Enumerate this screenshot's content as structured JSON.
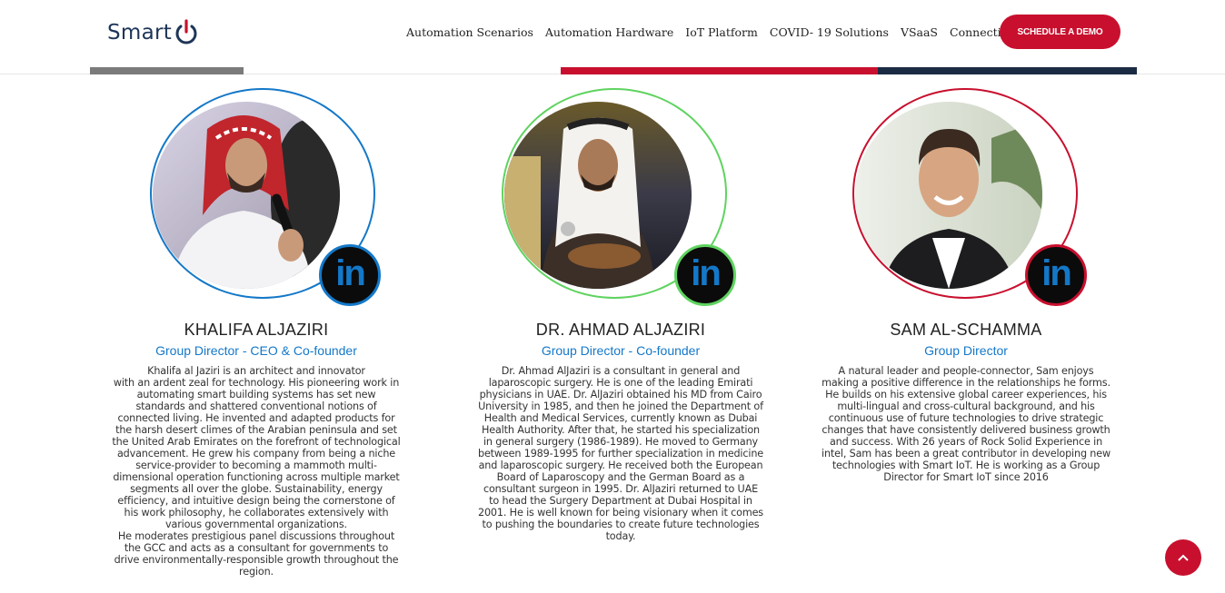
{
  "header": {
    "logo_text": "Smart",
    "nav": [
      "Automation Scenarios",
      "Automation Hardware",
      "IoT Platform",
      "COVID- 19 Solutions",
      "VSaaS",
      "Connectivity"
    ],
    "demo_button": "SCHEDULE A DEMO"
  },
  "colors": {
    "brand_red": "#c8102e",
    "navy": "#1b2b44",
    "link_blue": "#1478c8",
    "ring_blue": "#1478c8",
    "ring_green": "#5fd35f",
    "ring_red": "#c8102e"
  },
  "team": [
    {
      "name": "KHALIFA ALJAZIRI",
      "role": "Group Director - CEO & Co-founder",
      "bio": "Khalifa al Jaziri is an architect and innovator\nwith an ardent zeal for technology. His pioneering work in\nautomating smart building systems has set new\nstandards and shattered conventional notions of\nconnected living. He invented and adapted products for\nthe harsh desert climes of the Arabian peninsula and set\nthe United Arab Emirates on the forefront of technological\nadvancement. He grew his company from being a niche\nservice-provider to becoming a mammoth multi-\ndimensional operation functioning across multiple market\nsegments all over the globe. Sustainability, energy\nefficiency, and intuitive design being the cornerstone of\nhis work philosophy, he collaborates extensively with\nvarious governmental organizations.\nHe moderates prestigious panel discussions throughout\nthe GCC and acts as a consultant for governments to\ndrive environmentally-responsible growth throughout the\nregion.",
      "linkedin": "in",
      "photo_icon": "portrait-khalifa"
    },
    {
      "name": "DR. AHMAD ALJAZIRI",
      "role": "Group Director - Co-founder",
      "bio": "Dr. Ahmad AlJaziri is a consultant in general and\nlaparoscopic surgery. He is one of the leading Emirati\nphysicians in UAE. Dr. AlJaziri obtained his MD from Cairo\nUniversity in 1985, and then he joined the Department of\nHealth and Medical Services, currently known as Dubai\nHealth Authority. After that, he started his specialization\nin general surgery (1986-1989). He moved to Germany\nbetween 1989-1995 for further specialization in medicine\nand laparoscopic surgery. He received both the European\nBoard of Laparoscopy and the German Board as a\nconsultant surgeon in 1995. Dr. AlJaziri returned to UAE\nto head the Surgery Department at Dubai Hospital in\n2001. He is well known for being visionary when it comes\nto pushing the boundaries to create future technologies\ntoday.",
      "linkedin": "in",
      "photo_icon": "portrait-ahmad"
    },
    {
      "name": "SAM AL-SCHAMMA",
      "role": "Group Director",
      "bio": "A natural leader and people-connector, Sam enjoys\nmaking a positive difference in the relationships he forms.\nHe builds on his extensive global career experiences, his\nmulti-lingual and cross-cultural background, and his\ncontinuous use of future technologies to drive strategic\nchanges that have consistently delivered business growth\nand success. With 26 years of Rock Solid Experience in\nintel, Sam has been a great contributor in developing new\ntechnologies with Smart IoT. He is working as a Group\nDirector for Smart IoT since 2016",
      "linkedin": "in",
      "photo_icon": "portrait-sam"
    }
  ]
}
